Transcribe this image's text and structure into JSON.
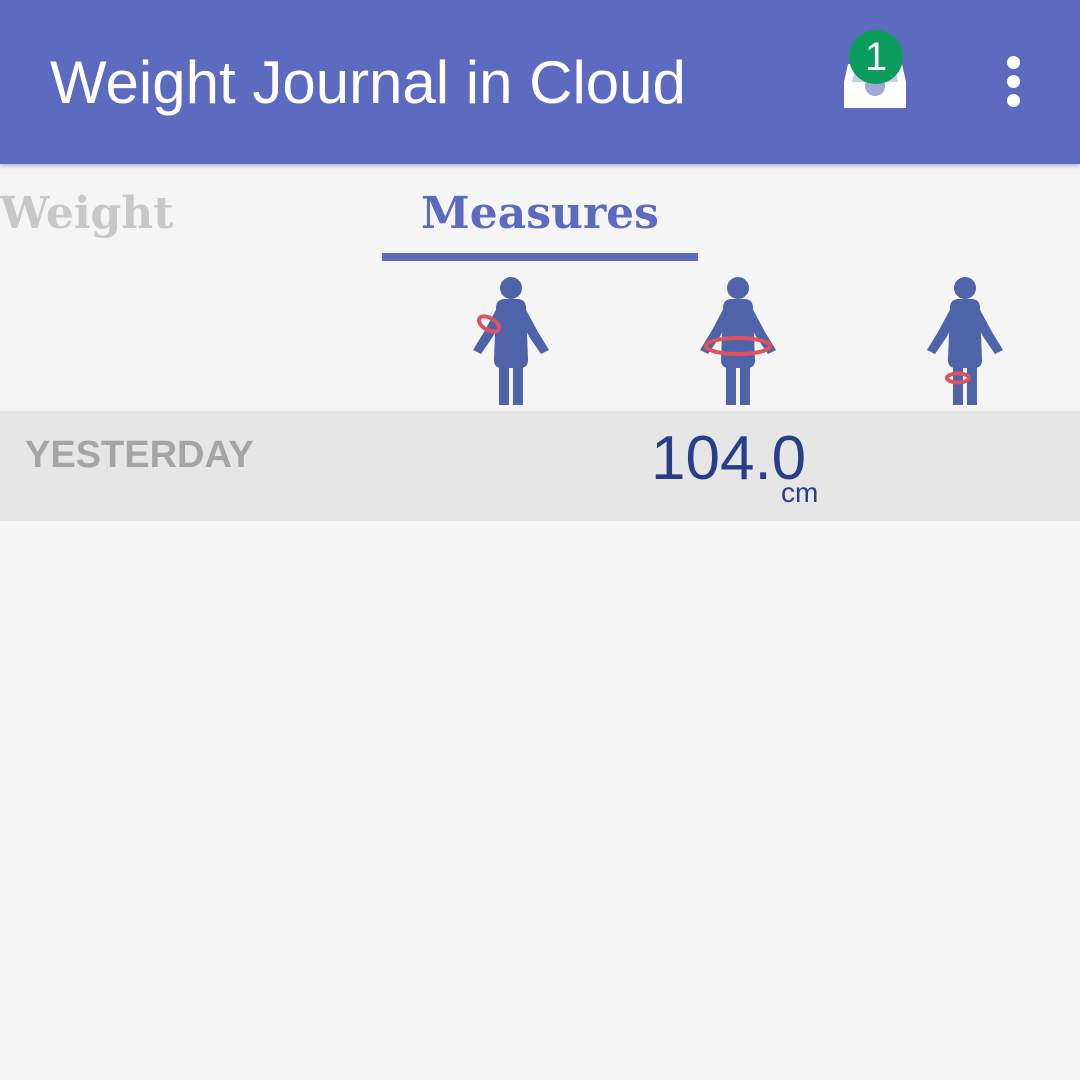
{
  "app_bar": {
    "title": "Weight Journal in Cloud",
    "inbox_badge": "1",
    "inbox_icon": "inbox-icon",
    "menu_icon": "more-vert-icon",
    "color": "#5c6bc0"
  },
  "tabs": [
    {
      "label": "Weight",
      "selected": false
    },
    {
      "label": "Measures",
      "selected": true
    }
  ],
  "measure_columns": [
    {
      "icon": "arm-measure-icon"
    },
    {
      "icon": "waist-measure-icon"
    },
    {
      "icon": "thigh-measure-icon"
    }
  ],
  "entries": [
    {
      "date": "YESTERDAY",
      "arm": "",
      "waist": "104.0",
      "waist_unit": "cm",
      "thigh": ""
    }
  ],
  "colors": {
    "accent": "#5c6bc0",
    "figure": "#4f64a8",
    "marker": "#e0515f",
    "value_text": "#273e8a",
    "badge": "#0b9d5c"
  }
}
